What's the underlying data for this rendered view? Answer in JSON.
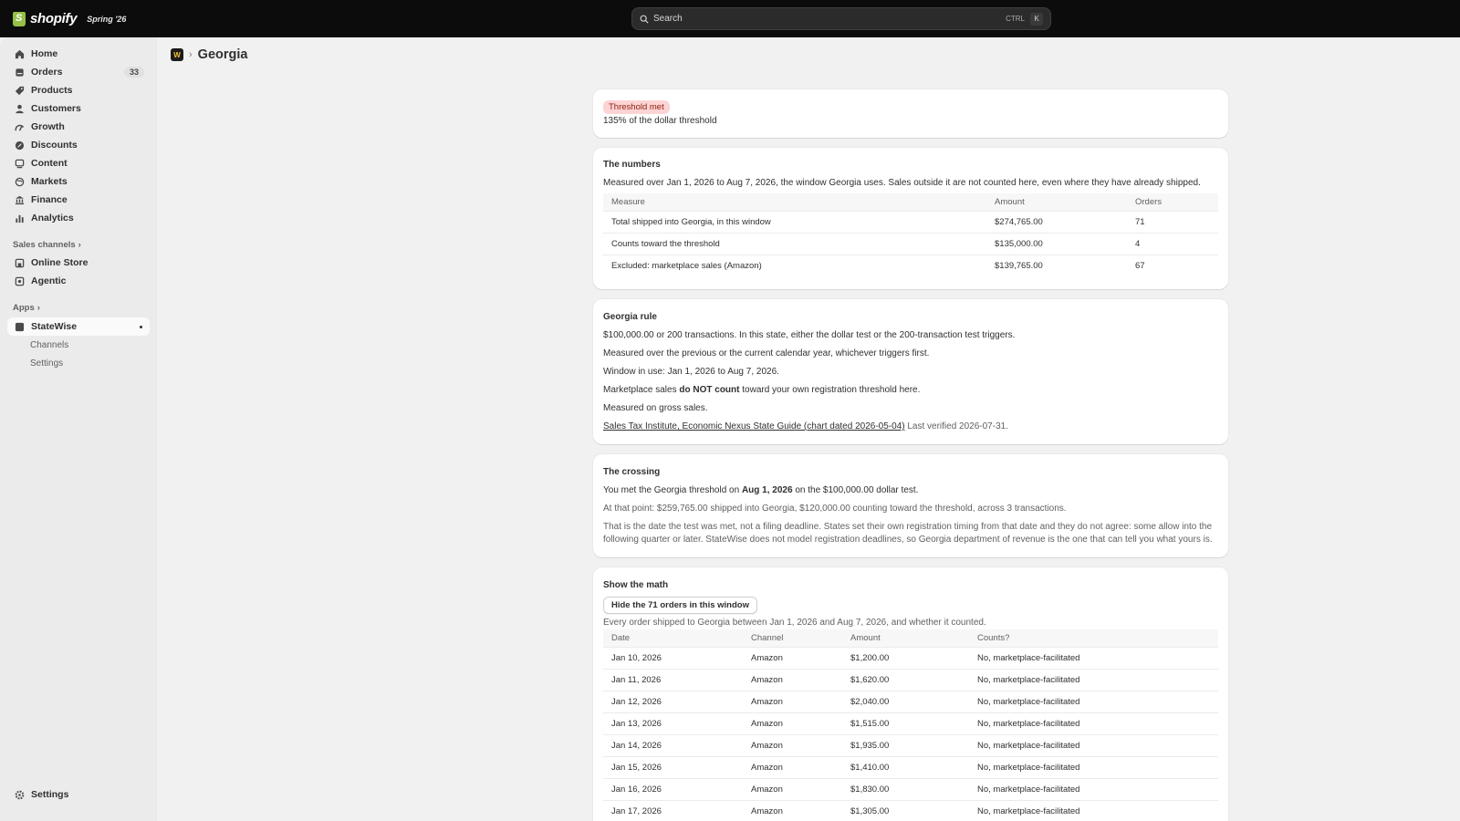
{
  "topbar": {
    "brand": "shopify",
    "edition": "Spring '26",
    "search_placeholder": "Search",
    "shortcut_mod": "CTRL",
    "shortcut_key": "K"
  },
  "sidebar": {
    "items": [
      {
        "label": "Home",
        "icon": "home-icon"
      },
      {
        "label": "Orders",
        "icon": "orders-icon",
        "badge": "33"
      },
      {
        "label": "Products",
        "icon": "tag-icon"
      },
      {
        "label": "Customers",
        "icon": "person-icon"
      },
      {
        "label": "Growth",
        "icon": "growth-icon"
      },
      {
        "label": "Discounts",
        "icon": "discount-icon"
      },
      {
        "label": "Content",
        "icon": "content-icon"
      },
      {
        "label": "Markets",
        "icon": "globe-icon"
      },
      {
        "label": "Finance",
        "icon": "bank-icon"
      },
      {
        "label": "Analytics",
        "icon": "bar-chart-icon"
      }
    ],
    "sales_channels_label": "Sales channels",
    "channels": [
      {
        "label": "Online Store",
        "icon": "store-icon"
      },
      {
        "label": "Agentic",
        "icon": "agent-icon"
      }
    ],
    "apps_label": "Apps",
    "app": {
      "label": "StateWise",
      "icon": "app-icon"
    },
    "app_subitems": [
      "Channels",
      "Settings"
    ],
    "settings_label": "Settings"
  },
  "breadcrumb": {
    "app_logo": "W",
    "title": "Georgia"
  },
  "status_card": {
    "badge": "Threshold met",
    "detail": "135% of the dollar threshold"
  },
  "numbers_card": {
    "title": "The numbers",
    "description": "Measured over Jan 1, 2026 to Aug 7, 2026, the window Georgia uses. Sales outside it are not counted here, even where they have already shipped.",
    "headers": [
      "Measure",
      "Amount",
      "Orders"
    ],
    "rows": [
      [
        "Total shipped into Georgia, in this window",
        "$274,765.00",
        "71"
      ],
      [
        "Counts toward the threshold",
        "$135,000.00",
        "4"
      ],
      [
        "Excluded: marketplace sales (Amazon)",
        "$139,765.00",
        "67"
      ]
    ]
  },
  "rule_card": {
    "title": "Georgia rule",
    "line1": "$100,000.00 or 200 transactions. In this state, either the dollar test or the 200-transaction test triggers.",
    "line2": "Measured over the previous or the current calendar year, whichever triggers first.",
    "line3": "Window in use: Jan 1, 2026 to Aug 7, 2026.",
    "line4_pre": "Marketplace sales ",
    "line4_bold": "do NOT count",
    "line4_post": " toward your own registration threshold here.",
    "line5": "Measured on gross sales.",
    "source_link": "Sales Tax Institute, Economic Nexus State Guide (chart dated 2026-05-04)",
    "verified": "Last verified 2026-07-31."
  },
  "crossing_card": {
    "title": "The crossing",
    "line1_pre": "You met the Georgia threshold on ",
    "line1_bold": "Aug 1, 2026",
    "line1_post": " on the $100,000.00 dollar test.",
    "line2": "At that point: $259,765.00 shipped into Georgia, $120,000.00 counting toward the threshold, across 3 transactions.",
    "line3a": "That is the date the test was met, not a filing deadline. States set their own registration timing from that date and they do not agree: some allow into the",
    "line3b": "following quarter or later. StateWise does not model registration deadlines, so Georgia department of revenue is the one that can tell you what yours is."
  },
  "math_card": {
    "title": "Show the math",
    "toggle_button": "Hide the 71 orders in this window",
    "description": "Every order shipped to Georgia between Jan 1, 2026 and Aug 7, 2026, and whether it counted.",
    "headers": [
      "Date",
      "Channel",
      "Amount",
      "Counts?"
    ],
    "rows": [
      [
        "Jan 10, 2026",
        "Amazon",
        "$1,200.00",
        "No, marketplace-facilitated"
      ],
      [
        "Jan 11, 2026",
        "Amazon",
        "$1,620.00",
        "No, marketplace-facilitated"
      ],
      [
        "Jan 12, 2026",
        "Amazon",
        "$2,040.00",
        "No, marketplace-facilitated"
      ],
      [
        "Jan 13, 2026",
        "Amazon",
        "$1,515.00",
        "No, marketplace-facilitated"
      ],
      [
        "Jan 14, 2026",
        "Amazon",
        "$1,935.00",
        "No, marketplace-facilitated"
      ],
      [
        "Jan 15, 2026",
        "Amazon",
        "$1,410.00",
        "No, marketplace-facilitated"
      ],
      [
        "Jan 16, 2026",
        "Amazon",
        "$1,830.00",
        "No, marketplace-facilitated"
      ],
      [
        "Jan 17, 2026",
        "Amazon",
        "$1,305.00",
        "No, marketplace-facilitated"
      ]
    ]
  },
  "colors": {
    "topbar": "#0c0c0c",
    "threshold_badge_bg": "#fcd4d4",
    "threshold_badge_text": "#8e1f0b"
  }
}
